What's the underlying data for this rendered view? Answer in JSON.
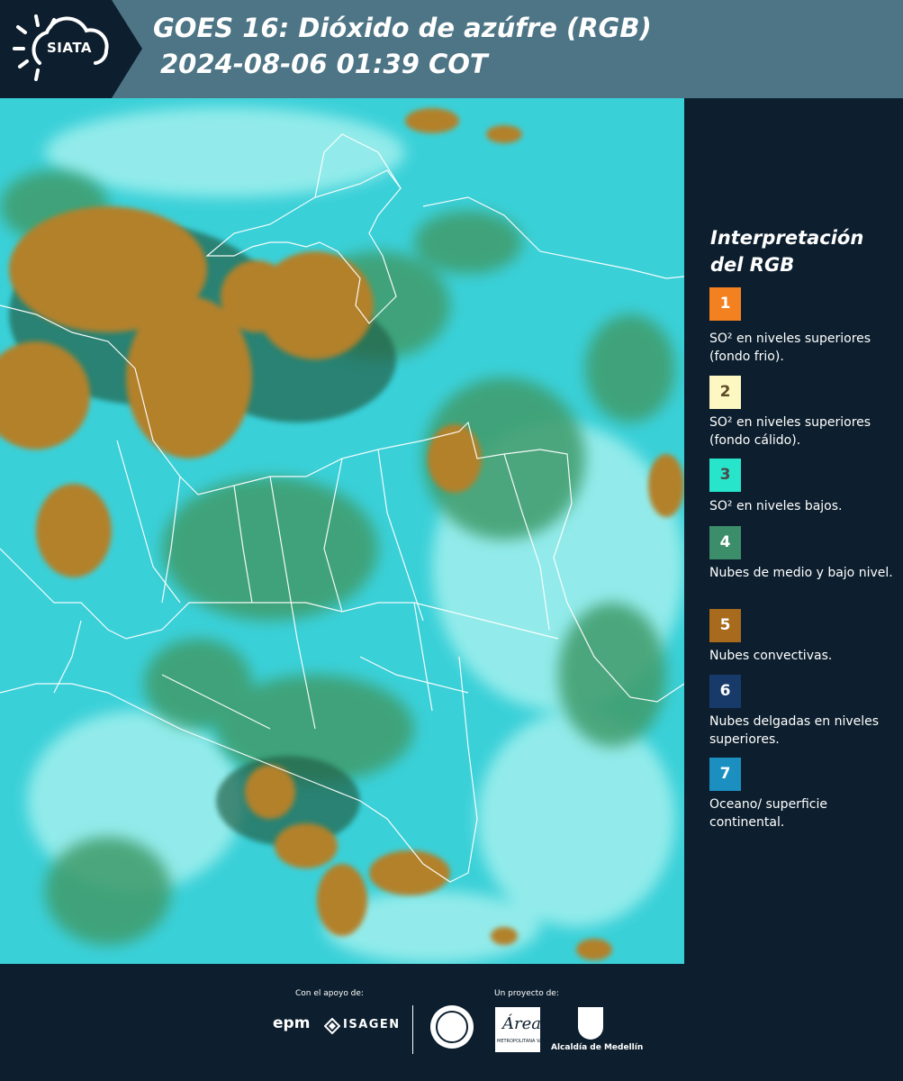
{
  "header": {
    "logo_text": "SIATA",
    "title_line1": "GOES 16: Dióxido de azúfre (RGB)",
    "title_line2": "2024-08-06 01:39 COT"
  },
  "legend": {
    "title_line1": "Interpretación",
    "title_line2": "del RGB",
    "items": [
      {
        "number": "1",
        "color": "#f48120",
        "text_color": "#ffffff",
        "label": "SO² en niveles superiores (fondo frio)."
      },
      {
        "number": "2",
        "color": "#fdf7c2",
        "text_color": "#5a4a2a",
        "label": "SO² en niveles superiores (fondo cálido)."
      },
      {
        "number": "3",
        "color": "#27e5cb",
        "text_color": "#4a4a4a",
        "label": "SO² en niveles bajos."
      },
      {
        "number": "4",
        "color": "#3c8d6a",
        "text_color": "#ffffff",
        "label": "Nubes de medio y bajo nivel."
      },
      {
        "number": "5",
        "color": "#a86a1c",
        "text_color": "#ffffff",
        "label": "Nubes convectivas."
      },
      {
        "number": "6",
        "color": "#173a6a",
        "text_color": "#ffffff",
        "label": "Nubes delgadas en niveles superiores."
      },
      {
        "number": "7",
        "color": "#1a8fc0",
        "text_color": "#ffffff",
        "label": "Oceano/ superficie continental."
      }
    ]
  },
  "footer": {
    "support_label": "Con el apoyo de:",
    "project_label": "Un proyecto de:",
    "sponsor_epm": "epm",
    "sponsor_isagen": "ISAGEN",
    "amva_text": "Área",
    "amva_sub": "METROPOLITANA Valle de Aburrá",
    "alcaldia": "Alcaldía de Medellín"
  },
  "colors": {
    "background": "#0d1f2e",
    "header_band": "#4d7585",
    "map_cyan": "#3ad0d8",
    "map_green": "#3f9b6a",
    "convective_brown": "#b2812c"
  }
}
